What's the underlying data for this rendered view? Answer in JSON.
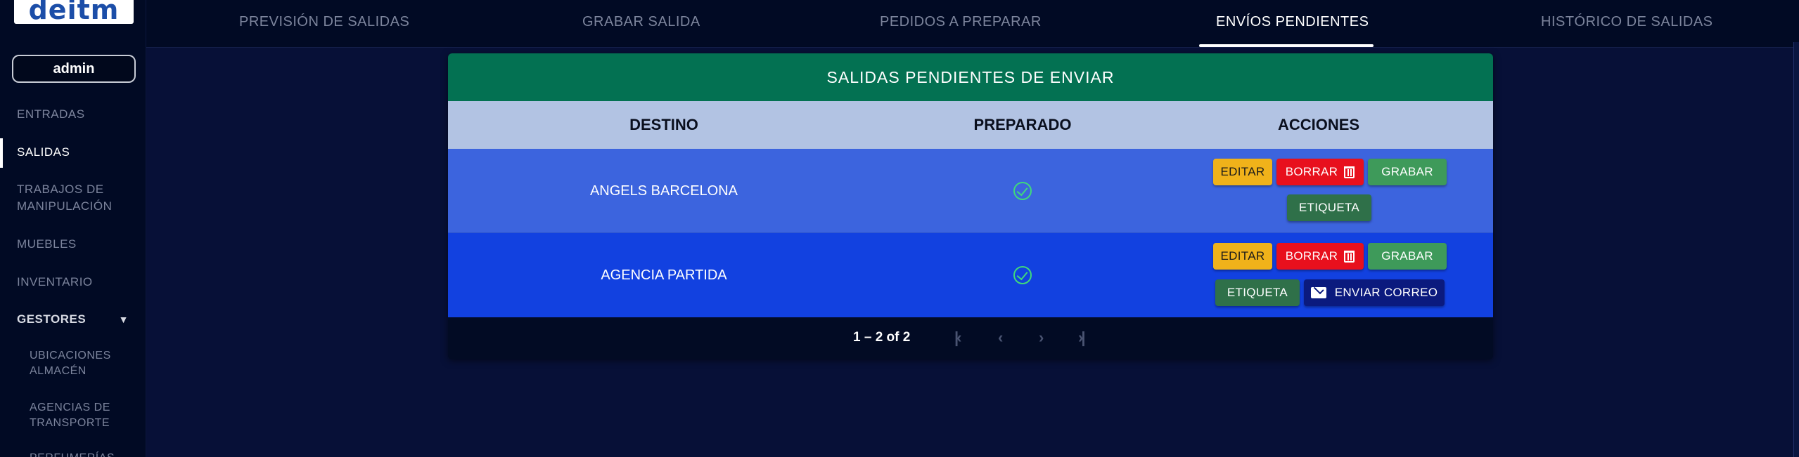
{
  "app": {
    "logo_text": "deitm",
    "user": "admin"
  },
  "sidebar": {
    "items": [
      {
        "label": "ENTRADAS"
      },
      {
        "label": "SALIDAS"
      },
      {
        "label": "TRABAJOS DE\nMANIPULACIÓN"
      },
      {
        "label": "MUEBLES"
      },
      {
        "label": "INVENTARIO"
      },
      {
        "label": "GESTORES"
      }
    ],
    "sub_items": [
      {
        "label": "UBICACIONES\nALMACÉN"
      },
      {
        "label": "AGENCIAS DE\nTRANSPORTE"
      },
      {
        "label": "PERFUMERÍAS"
      }
    ]
  },
  "tabs": [
    {
      "label": "PREVISIÓN DE SALIDAS"
    },
    {
      "label": "GRABAR SALIDA"
    },
    {
      "label": "PEDIDOS A PREPARAR"
    },
    {
      "label": "ENVÍOS PENDIENTES"
    },
    {
      "label": "HISTÓRICO DE SALIDAS"
    }
  ],
  "card": {
    "title": "SALIDAS PENDIENTES DE ENVIAR",
    "headers": {
      "destino": "DESTINO",
      "preparado": "PREPARADO",
      "acciones": "ACCIONES"
    },
    "rows": [
      {
        "destino": "ANGELS BARCELONA",
        "preparado": true
      },
      {
        "destino": "AGENCIA PARTIDA",
        "preparado": true
      }
    ],
    "buttons": {
      "edit": "EDITAR",
      "delete": "BORRAR",
      "record": "GRABAR",
      "label": "ETIQUETA",
      "send_mail": "ENVIAR CORREO"
    },
    "pagination": {
      "range": "1 – 2 of 2"
    }
  },
  "colors": {
    "header_green": "#037152",
    "thead": "#b2c3e3",
    "row1": "#3c64de",
    "row2": "#1241e0",
    "edit": "#f0b21a",
    "delete": "#e8101d",
    "record": "#3e9a5a",
    "label": "#2f7049",
    "mail": "#0b1a7e"
  }
}
